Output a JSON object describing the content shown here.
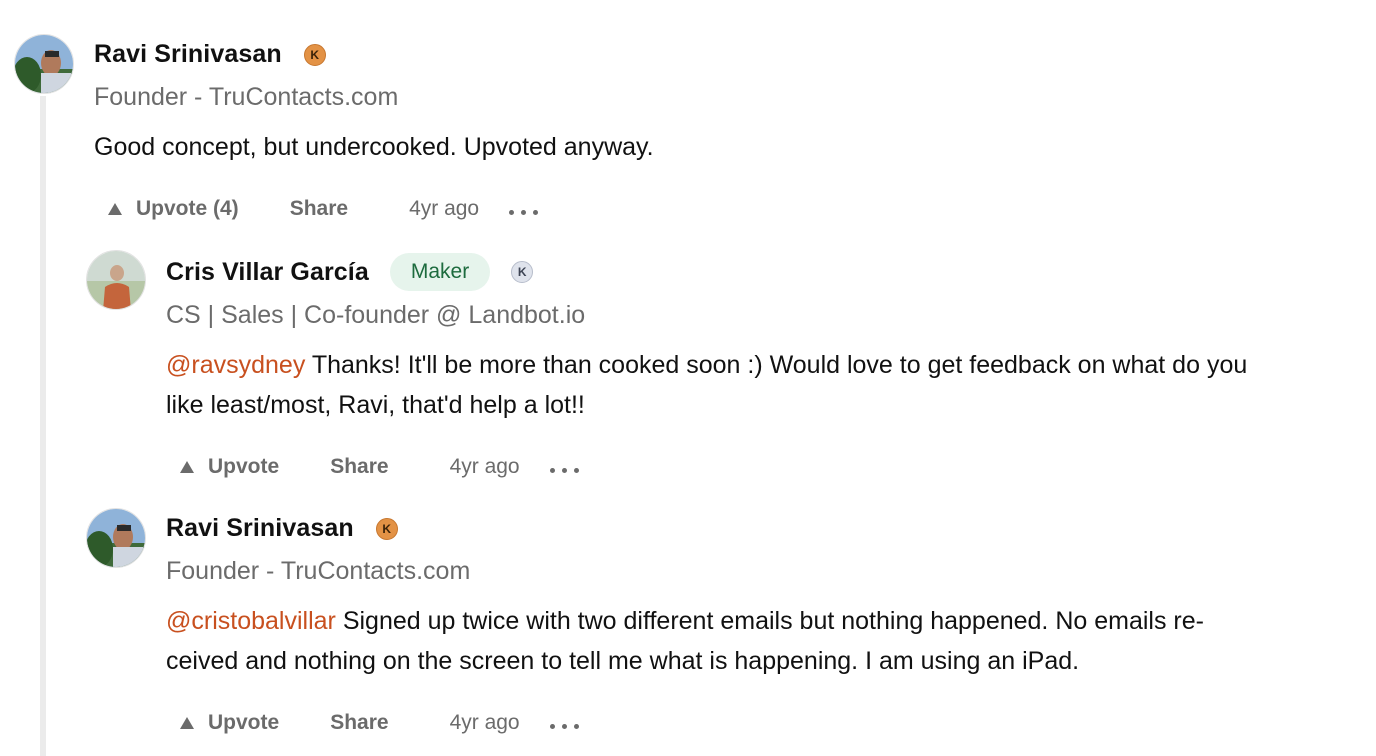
{
  "comments": [
    {
      "author": "Ravi Srinivasan",
      "badge": "K",
      "headline": "Founder - TruContacts.com",
      "body": "Good concept, but undercooked. Upvoted anyway.",
      "upvote_label": "Upvote (4)",
      "share_label": "Share",
      "time": "4yr ago",
      "more_icon": "ellipsis-icon"
    },
    {
      "author": "Cris Villar García",
      "maker_label": "Maker",
      "badge": "K",
      "headline": "CS | Sales | Co-founder @ Landbot.io",
      "mention": "@ravsydney",
      "body_line1": " Thanks! It'll be more than cooked soon :) Would love to get feedback on what do you",
      "body_line2": "like least/most, Ravi, that'd help a lot!!",
      "upvote_label": "Upvote",
      "share_label": "Share",
      "time": "4yr ago"
    },
    {
      "author": "Ravi Srinivasan",
      "badge": "K",
      "headline": "Founder - TruContacts.com",
      "mention": "@cristobalvillar",
      "body_line1": " Signed up twice with two different emails but nothing happened. No emails re-",
      "body_line2": "ceived and nothing on the screen to tell me what is happening. I am using an iPad.",
      "upvote_label": "Upvote",
      "share_label": "Share",
      "time": "4yr ago"
    }
  ],
  "colors": {
    "mention": "#c8501f",
    "maker_bg": "#e6f4ec",
    "maker_text": "#1d6b3e",
    "badge_orange": "#e39245",
    "badge_grey": "#dfe3ec",
    "thread_line": "#ebebeb"
  }
}
